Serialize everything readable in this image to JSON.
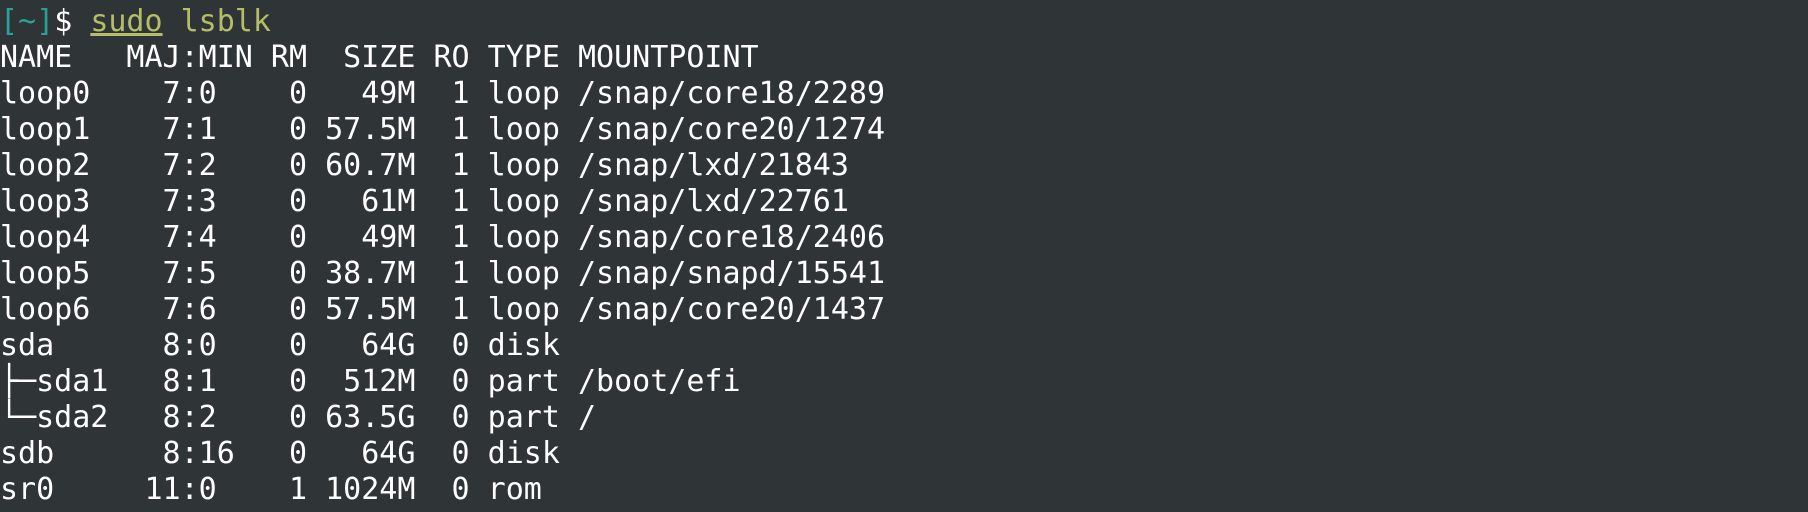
{
  "prompt": {
    "dir": "[~]",
    "symbol": "$",
    "command": "sudo",
    "argument": "lsblk"
  },
  "output_lines": [
    "NAME   MAJ:MIN RM  SIZE RO TYPE MOUNTPOINT",
    "loop0    7:0    0   49M  1 loop /snap/core18/2289",
    "loop1    7:1    0 57.5M  1 loop /snap/core20/1274",
    "loop2    7:2    0 60.7M  1 loop /snap/lxd/21843",
    "loop3    7:3    0   61M  1 loop /snap/lxd/22761",
    "loop4    7:4    0   49M  1 loop /snap/core18/2406",
    "loop5    7:5    0 38.7M  1 loop /snap/snapd/15541",
    "loop6    7:6    0 57.5M  1 loop /snap/core20/1437",
    "sda      8:0    0   64G  0 disk ",
    "├─sda1   8:1    0  512M  0 part /boot/efi",
    "└─sda2   8:2    0 63.5G  0 part /",
    "sdb      8:16   0   64G  0 disk ",
    "sr0     11:0    1 1024M  0 rom  "
  ]
}
